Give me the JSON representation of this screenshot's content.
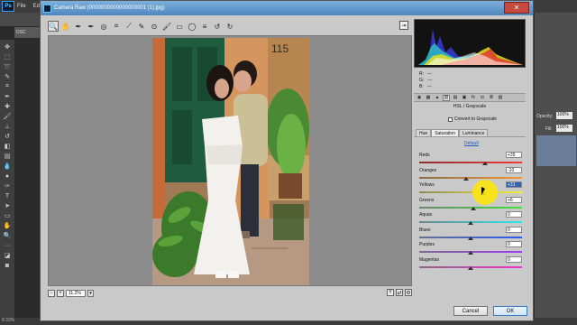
{
  "ps": {
    "logo": "Ps",
    "menu": [
      "File",
      "Ed"
    ],
    "doc_tab": "DSC",
    "status": "8.33%",
    "right_labels": [
      "Opacity:",
      "Fill:"
    ],
    "right_values": [
      "100%",
      "100%"
    ]
  },
  "camera_raw": {
    "title": "Camera Raw (0000000000000000001 (1).jpg)",
    "zoom": "11.2%",
    "rgb": {
      "r_label": "R:",
      "g_label": "G:",
      "b_label": "B:",
      "r": "---",
      "g": "---",
      "b": "---"
    },
    "panel_title": "HSL / Grayscale",
    "convert_label": "Convert to Grayscale",
    "subtabs": [
      "Hue",
      "Saturation",
      "Luminance"
    ],
    "active_subtab": "Saturation",
    "default_link": "Default",
    "sliders": [
      {
        "label": "Reds",
        "value": "+35",
        "pos": 0.64,
        "colors": [
          "#8f2e2e",
          "#f23a3a"
        ]
      },
      {
        "label": "Oranges",
        "value": "-10",
        "pos": 0.46,
        "colors": [
          "#8a6c4f",
          "#f5952e"
        ]
      },
      {
        "label": "Yellows",
        "value": "+31",
        "pos": 0.62,
        "colors": [
          "#8d8a5a",
          "#f4ef2f"
        ]
      },
      {
        "label": "Greens",
        "value": "+6",
        "pos": 0.53,
        "colors": [
          "#6e856c",
          "#3ee23d"
        ]
      },
      {
        "label": "Aquas",
        "value": "0",
        "pos": 0.5,
        "colors": [
          "#6b8687",
          "#2fe6f0"
        ]
      },
      {
        "label": "Blues",
        "value": "0",
        "pos": 0.5,
        "colors": [
          "#66708d",
          "#2b5cf2"
        ]
      },
      {
        "label": "Purples",
        "value": "0",
        "pos": 0.5,
        "colors": [
          "#7c6a8c",
          "#9d3ef2"
        ]
      },
      {
        "label": "Magentas",
        "value": "0",
        "pos": 0.5,
        "colors": [
          "#8a6683",
          "#ef34d0"
        ]
      }
    ],
    "selected_slider": 2,
    "buttons": {
      "cancel": "Cancel",
      "ok": "OK"
    },
    "photo_number": "115"
  }
}
